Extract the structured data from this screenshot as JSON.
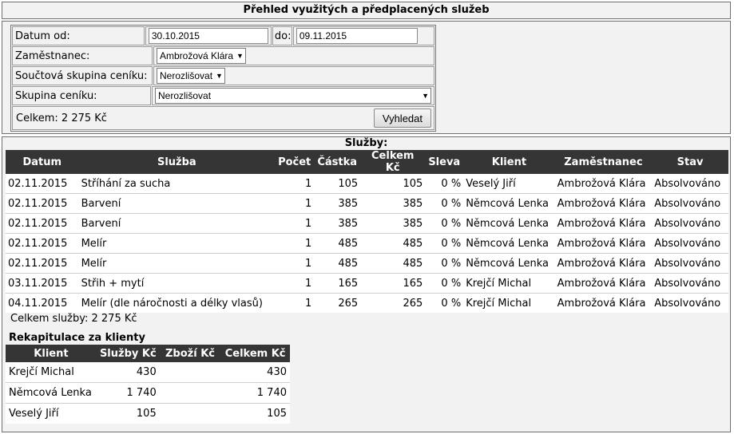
{
  "title": "Přehled využitých a předplacených služeb",
  "filters": {
    "date_from_label": "Datum od:",
    "date_from_value": "30.10.2015",
    "date_to_label": "do:",
    "date_to_value": "09.11.2015",
    "employee_label": "Zaměstnanec:",
    "employee_value": "Ambrožová Klára",
    "sum_group_label": "Součtová skupina ceníku:",
    "sum_group_value": "Nerozlišovat",
    "price_group_label": "Skupina ceníku:",
    "price_group_value": "Nerozlišovat",
    "total_text": "Celkem: 2 275 Kč",
    "search_label": "Vyhledat"
  },
  "services": {
    "title": "Služby:",
    "headers": [
      "Datum",
      "Služba",
      "Počet",
      "Částka",
      "Celkem Kč",
      "Sleva",
      "Klient",
      "Zaměstnanec",
      "Stav"
    ],
    "rows": [
      [
        "02.11.2015",
        "Stříhání za sucha",
        "1",
        "105",
        "105",
        "0 %",
        "Veselý Jiří",
        "Ambrožová Klára",
        "Absolvováno"
      ],
      [
        "02.11.2015",
        "Barvení",
        "1",
        "385",
        "385",
        "0 %",
        "Němcová Lenka",
        "Ambrožová Klára",
        "Absolvováno"
      ],
      [
        "02.11.2015",
        "Barvení",
        "1",
        "385",
        "385",
        "0 %",
        "Němcová Lenka",
        "Ambrožová Klára",
        "Absolvováno"
      ],
      [
        "02.11.2015",
        "Melír",
        "1",
        "485",
        "485",
        "0 %",
        "Němcová Lenka",
        "Ambrožová Klára",
        "Absolvováno"
      ],
      [
        "02.11.2015",
        "Melír",
        "1",
        "485",
        "485",
        "0 %",
        "Němcová Lenka",
        "Ambrožová Klára",
        "Absolvováno"
      ],
      [
        "03.11.2015",
        "Střih + mytí",
        "1",
        "165",
        "165",
        "0 %",
        "Krejčí Michal",
        "Ambrožová Klára",
        "Absolvováno"
      ],
      [
        "04.11.2015",
        "Melír (dle náročnosti a délky vlasů)",
        "1",
        "265",
        "265",
        "0 %",
        "Krejčí Michal",
        "Ambrožová Klára",
        "Absolvováno"
      ]
    ],
    "total_text": "Celkem služby: 2 275 Kč"
  },
  "recap": {
    "title": "Rekapitulace za klienty",
    "headers": [
      "Klient",
      "Služby Kč",
      "Zboží Kč",
      "Celkem Kč"
    ],
    "rows": [
      [
        "Krejčí Michal",
        "430",
        "",
        "430"
      ],
      [
        "Němcová Lenka",
        "1 740",
        "",
        "1 740"
      ],
      [
        "Veselý Jiří",
        "105",
        "",
        "105"
      ]
    ]
  }
}
